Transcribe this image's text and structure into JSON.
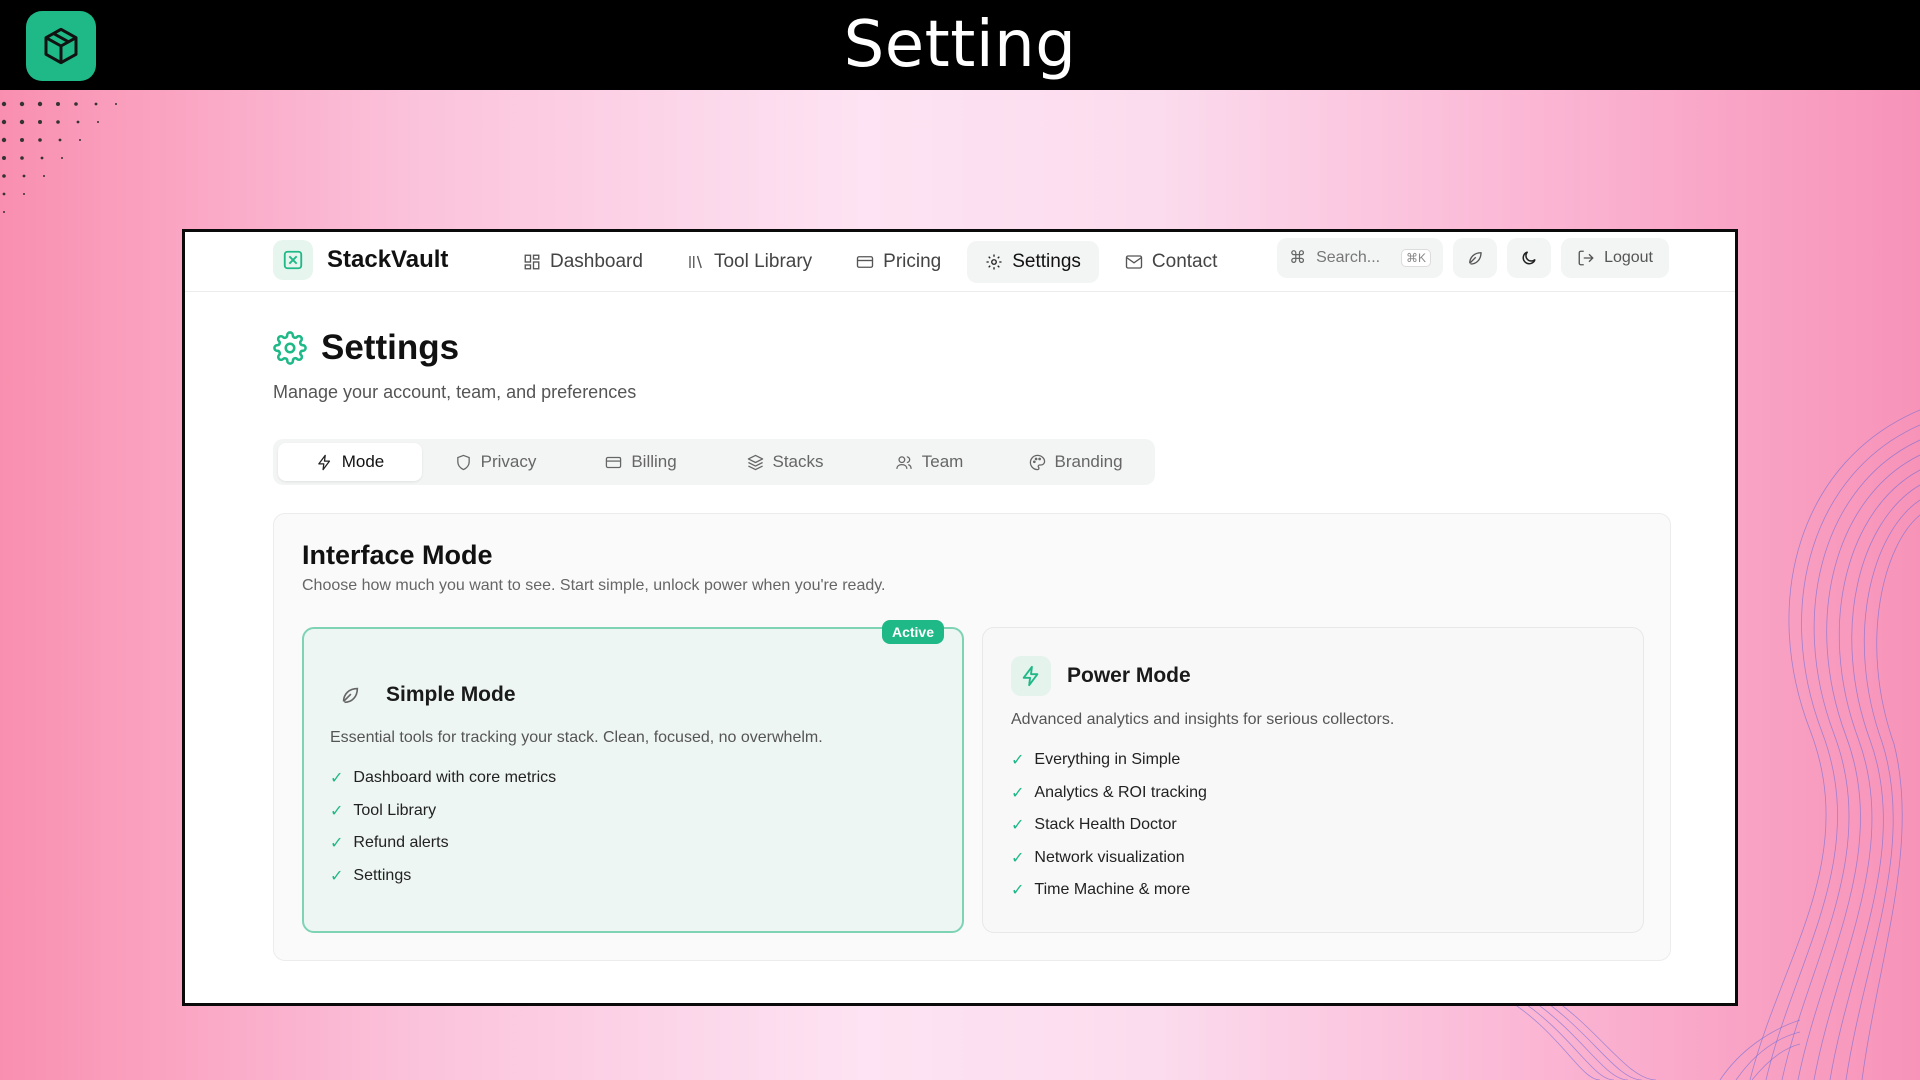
{
  "banner": {
    "title": "Setting"
  },
  "app": {
    "name": "StackVault"
  },
  "nav": {
    "links": [
      {
        "label": "Dashboard",
        "icon": "grid-icon"
      },
      {
        "label": "Tool Library",
        "icon": "library-icon"
      },
      {
        "label": "Pricing",
        "icon": "card-icon"
      },
      {
        "label": "Settings",
        "icon": "gear-icon",
        "active": true
      },
      {
        "label": "Contact",
        "icon": "mail-icon"
      }
    ],
    "search_placeholder": "Search...",
    "search_shortcut": "⌘K",
    "logout_label": "Logout"
  },
  "page": {
    "title": "Settings",
    "subtitle": "Manage your account, team, and preferences"
  },
  "tabs": [
    {
      "label": "Mode",
      "icon": "bolt-icon",
      "active": true
    },
    {
      "label": "Privacy",
      "icon": "shield-icon"
    },
    {
      "label": "Billing",
      "icon": "card-icon"
    },
    {
      "label": "Stacks",
      "icon": "layers-icon"
    },
    {
      "label": "Team",
      "icon": "users-icon"
    },
    {
      "label": "Branding",
      "icon": "palette-icon"
    }
  ],
  "interface_mode": {
    "title": "Interface Mode",
    "subtitle": "Choose how much you want to see. Start simple, unlock power when you're ready.",
    "simple": {
      "title": "Simple Mode",
      "badge": "Active",
      "description": "Essential tools for tracking your stack. Clean, focused, no overwhelm.",
      "features": [
        "Dashboard with core metrics",
        "Tool Library",
        "Refund alerts",
        "Settings"
      ]
    },
    "power": {
      "title": "Power Mode",
      "description": "Advanced analytics and insights for serious collectors.",
      "features": [
        "Everything in Simple",
        "Analytics & ROI tracking",
        "Stack Health Doctor",
        "Network visualization",
        "Time Machine & more"
      ]
    }
  },
  "colors": {
    "accent": "#1fb887",
    "accent_soft": "#e6f6ef",
    "banner_bg": "#000000"
  }
}
